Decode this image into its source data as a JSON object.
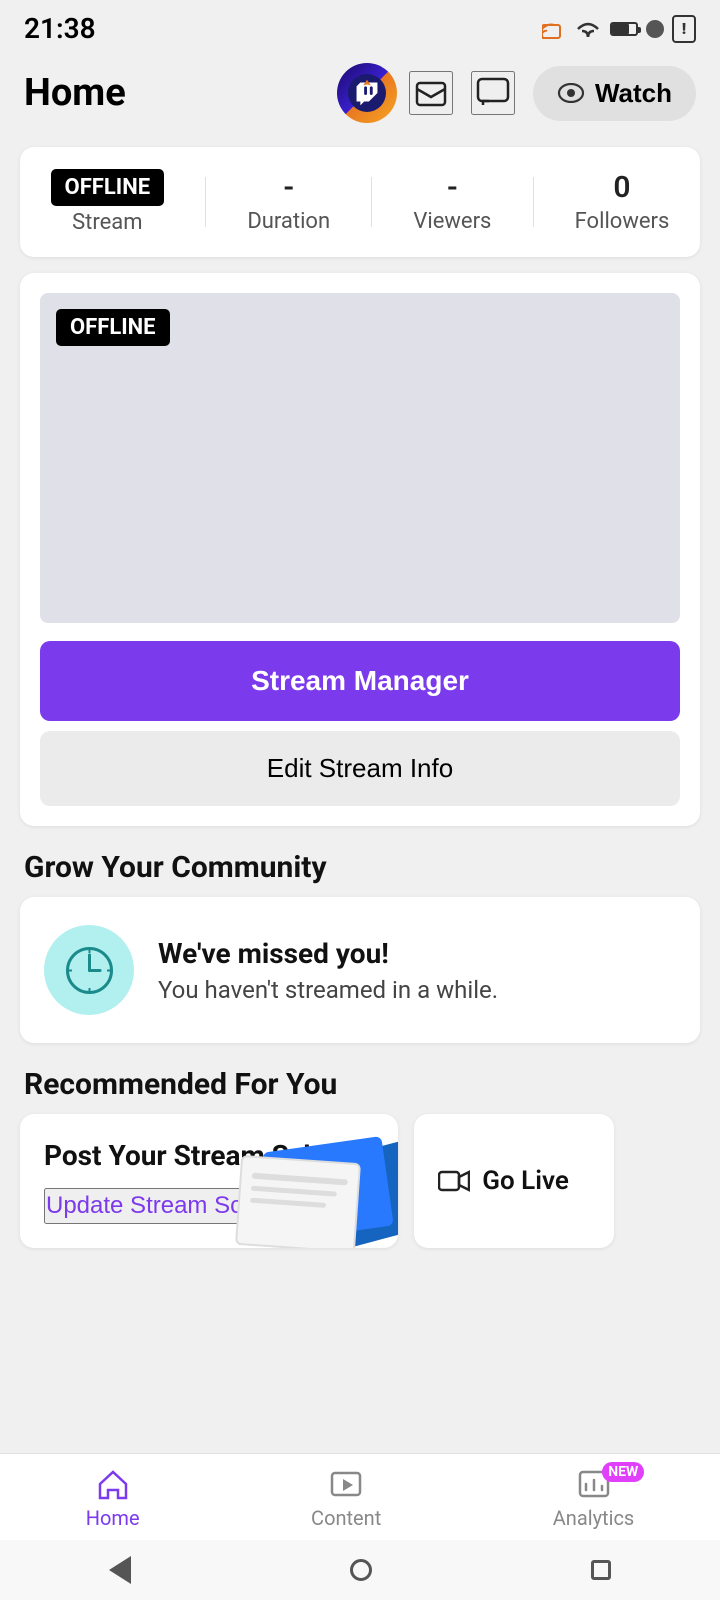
{
  "statusBar": {
    "time": "21:38",
    "icons": [
      "dot",
      "notification",
      "cast",
      "wifi",
      "battery"
    ]
  },
  "header": {
    "title": "Home",
    "watchLabel": "Watch"
  },
  "stats": {
    "offlineLabel": "OFFLINE",
    "streamLabel": "Stream",
    "durationValue": "-",
    "durationLabel": "Duration",
    "viewersValue": "-",
    "viewersLabel": "Viewers",
    "followersValue": "0",
    "followersLabel": "Followers"
  },
  "previewCard": {
    "offlineBadge": "OFFLINE",
    "streamManagerLabel": "Stream Manager",
    "editStreamLabel": "Edit Stream Info"
  },
  "growCommunity": {
    "sectionTitle": "Grow Your Community",
    "cardTitle": "We've missed you!",
    "cardSubtitle": "You haven't streamed in a while."
  },
  "recommended": {
    "sectionTitle": "Recommended For You",
    "card1Title": "Post Your Stream Schedule",
    "card1Link": "Update Stream Schedule",
    "card1Arrow": "›",
    "card2Label": "Go Live"
  },
  "bottomNav": {
    "homeLabel": "Home",
    "contentLabel": "Content",
    "analyticsLabel": "Analytics",
    "newBadge": "NEW"
  }
}
